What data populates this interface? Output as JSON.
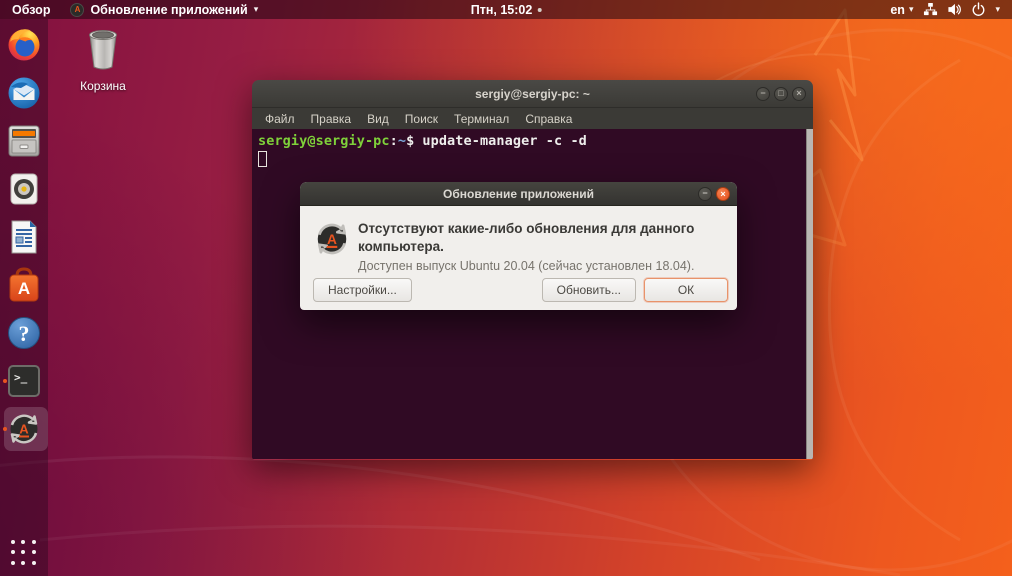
{
  "top_bar": {
    "activities_label": "Обзор",
    "app_menu_label": "Обновление приложений",
    "app_menu_icon_letter": "A",
    "clock": "Птн, 15:02",
    "keyboard_indicator": "en",
    "caret": "▾"
  },
  "desktop": {
    "trash_label": "Корзина"
  },
  "dock": {
    "items": [
      "firefox",
      "thunderbird",
      "files",
      "rhythmbox",
      "libreoffice-writer",
      "ubuntu-software",
      "help",
      "terminal",
      "software-updater"
    ]
  },
  "icon_glyphs": {
    "software_letter": "A",
    "updater_letter": "A",
    "help_question": "?",
    "terminal_prompt": "&gt;_"
  },
  "terminal_window": {
    "title": "sergiy@sergiy-pc: ~",
    "menu": [
      "Файл",
      "Правка",
      "Вид",
      "Поиск",
      "Терминал",
      "Справка"
    ],
    "prompt": {
      "user_host": "sergiy@sergiy-pc",
      "colon": ":",
      "path": "~",
      "dollar": "$"
    },
    "command": "update-manager -c -d",
    "controls": {
      "minimize": "−",
      "maximize": "□",
      "close": "×"
    }
  },
  "update_dialog": {
    "title": "Обновление приложений",
    "heading": [
      "Отсутствуют какие-либо обновления для данного",
      "компьютера."
    ],
    "detail": "Доступен выпуск Ubuntu 20.04 (сейчас установлен 18.04).",
    "buttons": {
      "settings": "Настройки...",
      "upgrade": "Обновить...",
      "ok": "ОК"
    },
    "controls": {
      "minimize": "−",
      "close": "×"
    }
  },
  "colors": {
    "accent_orange": "#e95420",
    "terminal_bg": "#300a24",
    "prompt_green": "#7fd13a",
    "path_blue": "#7ba6d8",
    "titlebar_gray": "#3b3a36",
    "dialog_bg": "#f1efec"
  }
}
